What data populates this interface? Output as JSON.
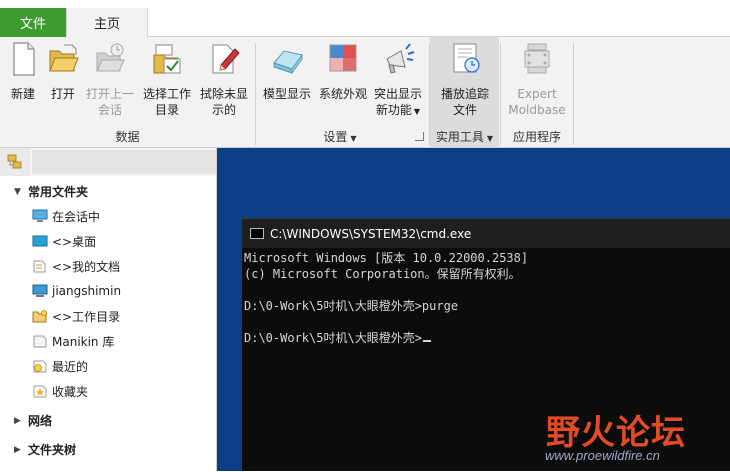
{
  "tabs": {
    "file": "文件",
    "home": "主页"
  },
  "ribbon": {
    "data_group": {
      "label": "数据",
      "new": "新建",
      "open": "打开",
      "open_last_1": "打开上一",
      "open_last_2": "会话",
      "select_dir_1": "选择工作",
      "select_dir_2": "目录",
      "erase_1": "拭除未显",
      "erase_2": "示的"
    },
    "settings_group": {
      "label": "设置",
      "model_display": "模型显示",
      "system_appearance": "系统外观",
      "highlight_1": "突出显示",
      "highlight_2": "新功能"
    },
    "practical_group": {
      "label": "实用工具",
      "playback_1": "播放追踪",
      "playback_2": "文件"
    },
    "apps_group": {
      "label": "应用程序",
      "expert_1": "Expert",
      "expert_2": "Moldbase"
    }
  },
  "navigator": {
    "common_folders": "常用文件夹",
    "items": [
      "在会话中",
      "<>桌面",
      "<>我的文档",
      "jiangshimin",
      "<>工作目录",
      "Manikin 库",
      "最近的",
      "收藏夹"
    ],
    "network": "网络",
    "folder_tree": "文件夹树"
  },
  "console": {
    "title": "C:\\WINDOWS\\SYSTEM32\\cmd.exe",
    "lines": [
      "Microsoft Windows [版本 10.0.22000.2538]",
      "(c) Microsoft Corporation。保留所有权利。",
      "D:\\0-Work\\5吋机\\大眼橙外壳>purge",
      "D:\\0-Work\\5吋机\\大眼橙外壳>"
    ]
  },
  "watermark": {
    "title": "野火论坛",
    "url": "www.proewildfire.cn"
  },
  "colors": {
    "file_tab": "#3d9b2f",
    "desktop": "#0a3f86",
    "console_bg": "#0c0c0c",
    "watermark": "#e24b25"
  }
}
